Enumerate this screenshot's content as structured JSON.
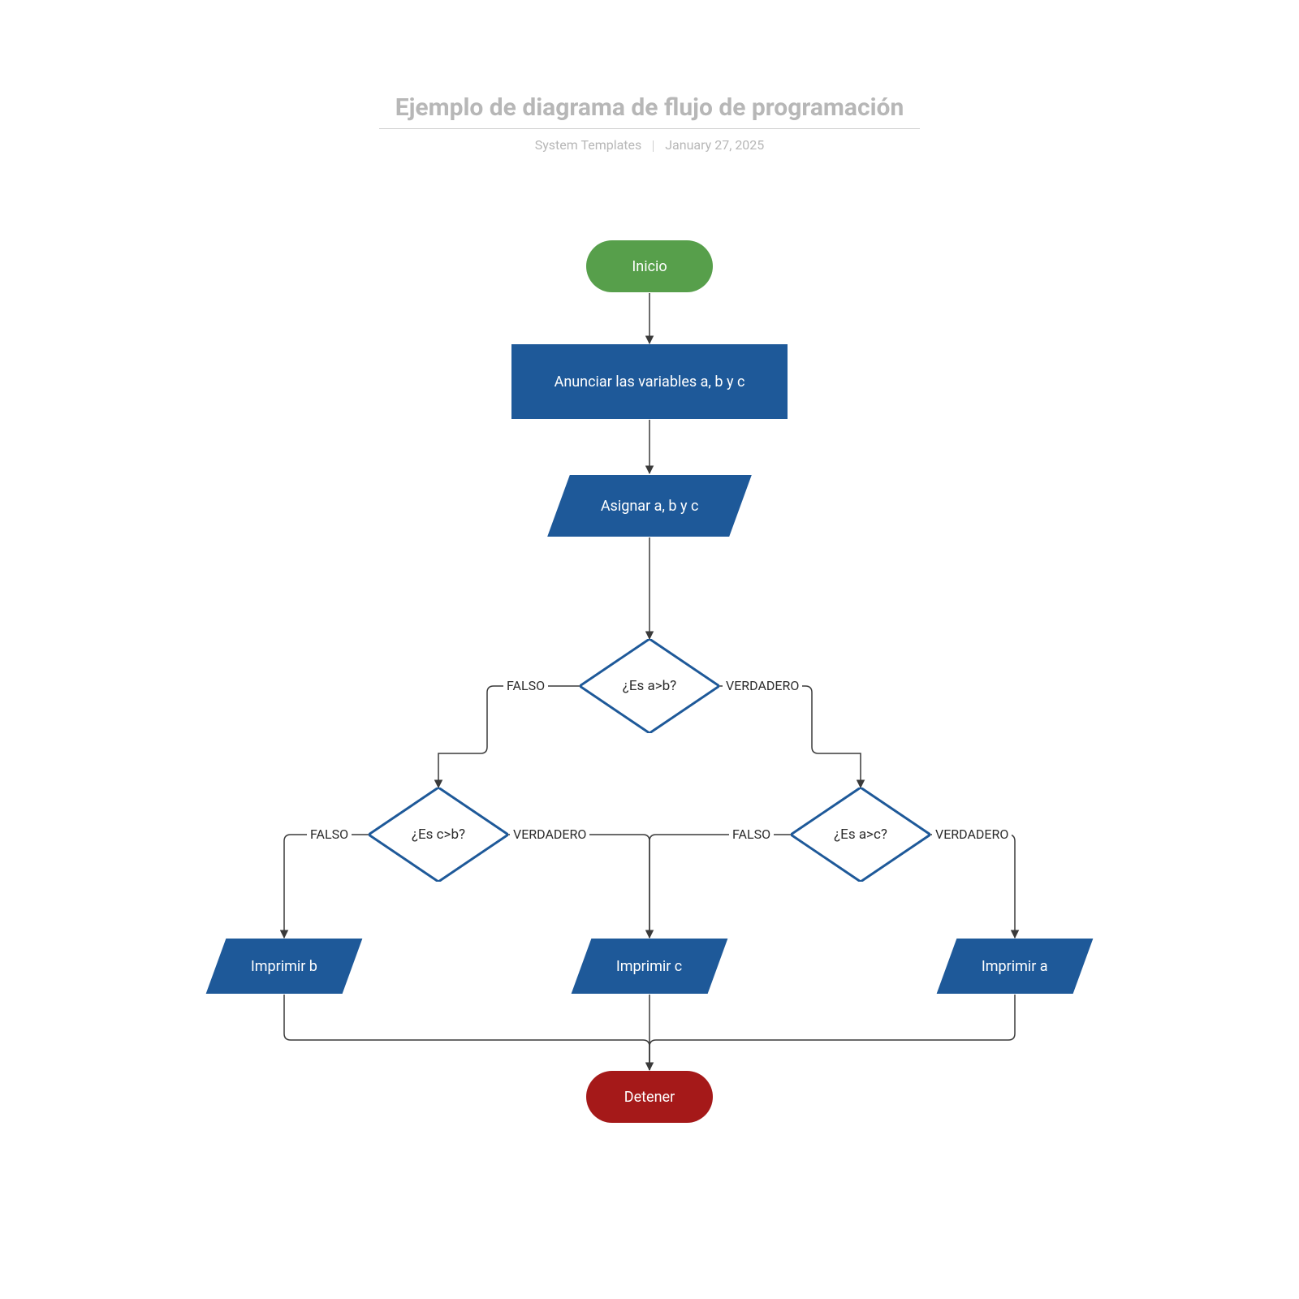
{
  "header": {
    "title": "Ejemplo de diagrama de flujo de programación",
    "author": "System Templates",
    "date": "January 27, 2025"
  },
  "labels": {
    "true": "VERDADERO",
    "false": "FALSO"
  },
  "nodes": {
    "start": "Inicio",
    "declare": "Anunciar las variables a, b y c",
    "assign": "Asignar a, b y c",
    "d_ab": "¿Es a>b?",
    "d_cb": "¿Es c>b?",
    "d_ac": "¿Es a>c?",
    "print_b": "Imprimir b",
    "print_c": "Imprimir c",
    "print_a": "Imprimir a",
    "stop": "Detener"
  },
  "chart_data": {
    "type": "flowchart",
    "title": "Ejemplo de diagrama de flujo de programación",
    "nodes": [
      {
        "id": "start",
        "type": "terminator",
        "label": "Inicio"
      },
      {
        "id": "declare",
        "type": "process",
        "label": "Anunciar las variables a, b y c"
      },
      {
        "id": "assign",
        "type": "io",
        "label": "Asignar a, b y c"
      },
      {
        "id": "d_ab",
        "type": "decision",
        "label": "¿Es a>b?"
      },
      {
        "id": "d_cb",
        "type": "decision",
        "label": "¿Es c>b?"
      },
      {
        "id": "d_ac",
        "type": "decision",
        "label": "¿Es a>c?"
      },
      {
        "id": "print_b",
        "type": "io",
        "label": "Imprimir b"
      },
      {
        "id": "print_c",
        "type": "io",
        "label": "Imprimir c"
      },
      {
        "id": "print_a",
        "type": "io",
        "label": "Imprimir a"
      },
      {
        "id": "stop",
        "type": "terminator",
        "label": "Detener"
      }
    ],
    "edges": [
      {
        "from": "start",
        "to": "declare"
      },
      {
        "from": "declare",
        "to": "assign"
      },
      {
        "from": "assign",
        "to": "d_ab"
      },
      {
        "from": "d_ab",
        "to": "d_cb",
        "label": "FALSO"
      },
      {
        "from": "d_ab",
        "to": "d_ac",
        "label": "VERDADERO"
      },
      {
        "from": "d_cb",
        "to": "print_b",
        "label": "FALSO"
      },
      {
        "from": "d_cb",
        "to": "print_c",
        "label": "VERDADERO"
      },
      {
        "from": "d_ac",
        "to": "print_c",
        "label": "FALSO"
      },
      {
        "from": "d_ac",
        "to": "print_a",
        "label": "VERDADERO"
      },
      {
        "from": "print_b",
        "to": "stop"
      },
      {
        "from": "print_c",
        "to": "stop"
      },
      {
        "from": "print_a",
        "to": "stop"
      }
    ]
  }
}
